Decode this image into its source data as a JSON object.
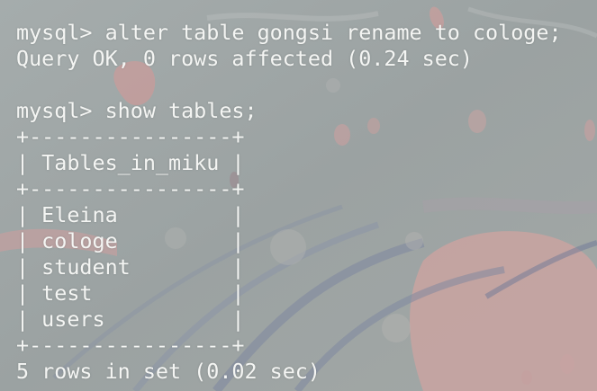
{
  "terminal": {
    "lines": [
      "mysql> alter table gongsi rename to cologe;",
      "Query OK, 0 rows affected (0.24 sec)",
      "",
      "mysql> show tables;",
      "+-------------+",
      "| Tables_in_miku |",
      "+-------------+",
      "| Eleina         |",
      "| cologe         |",
      "| student        |",
      "| test           |",
      "| users          |",
      "+-------------+",
      "5 rows in set (0.02 sec)"
    ],
    "ascii_border_lines": {
      "border_top": "+----------------+",
      "header_row": "| Tables_in_miku |",
      "border_mid": "+----------------+",
      "rows": [
        "| Eleina         |",
        "| cologe         |",
        "| student        |",
        "| test           |",
        "| users          |"
      ],
      "border_bottom": "+----------------+"
    },
    "colors": {
      "text": "#f4f5f3",
      "background": "#9fa6a6",
      "petal": "#d9a2a0"
    }
  }
}
